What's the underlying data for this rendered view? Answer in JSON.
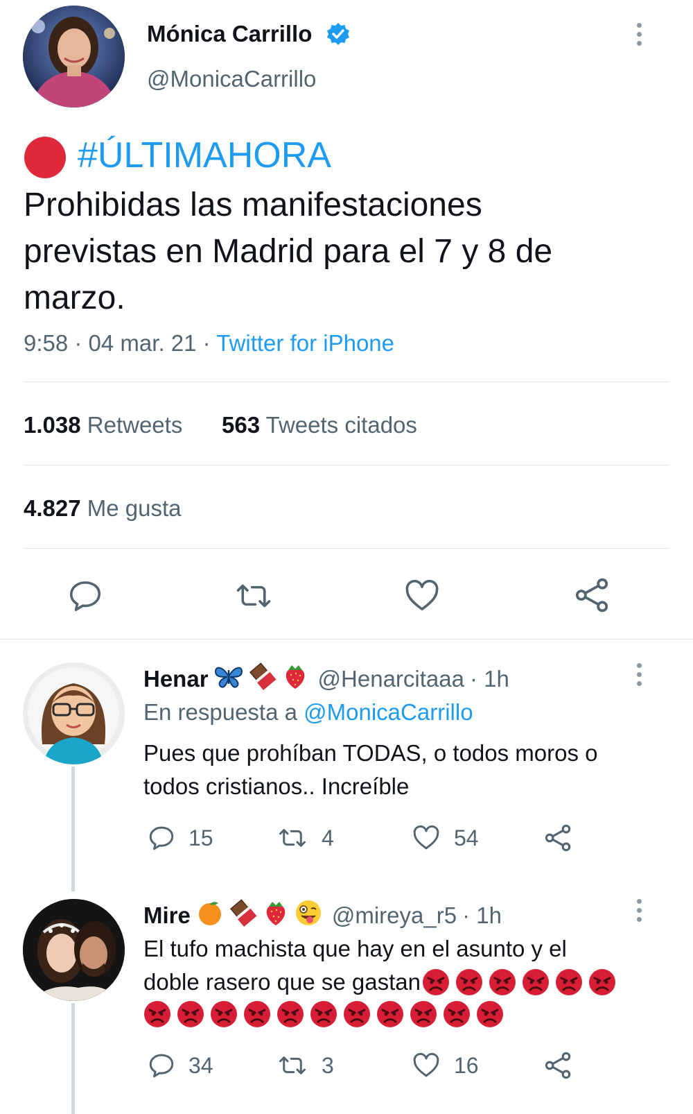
{
  "tweet": {
    "author_name": "Mónica Carrillo",
    "author_handle": "@MonicaCarrillo",
    "hashtag": "#ÚLTIMAHORA",
    "text_lines": [
      "Prohibidas las manifestaciones",
      "previstas en Madrid para el 7 y 8 de",
      "marzo."
    ],
    "timestamp": "9:58 · 04 mar. 21 ·",
    "source": "Twitter for iPhone",
    "stats": {
      "retweets_count": "1.038",
      "retweets_label": "Retweets",
      "quotes_count": "563",
      "quotes_label": "Tweets citados",
      "likes_count": "4.827",
      "likes_label": "Me gusta"
    },
    "actions": [
      "reply-icon",
      "retweet-icon",
      "like-icon",
      "share-icon"
    ]
  },
  "replies": [
    {
      "name": "Henar",
      "name_emojis": [
        "butterfly",
        "chocolate",
        "strawberry"
      ],
      "handle": "@Henarcitaaa",
      "time": "· 1h",
      "reply_to_label": "En respuesta a",
      "reply_to_handle": "@MonicaCarrillo",
      "text_lines": [
        "Pues que prohíban TODAS, o todos moros o",
        "todos cristianos.. Increíble"
      ],
      "replies": "15",
      "retweets": "4",
      "likes": "54"
    },
    {
      "name": "Mire",
      "name_emojis": [
        "orange",
        "chocolate",
        "strawberry",
        "zany-face"
      ],
      "handle": "@mireya_r5",
      "time": "· 1h",
      "text_lines": [
        "El tufo machista que hay en el asunto y el",
        "doble rasero que se gastan"
      ],
      "angry_emoji_count_line1": 6,
      "angry_emoji_count_line2": 11,
      "replies": "34",
      "retweets": "3",
      "likes": "16"
    }
  ],
  "colors": {
    "link": "#1d9bf0",
    "muted": "#536471",
    "divider": "#e1e8ed",
    "live_dot": "#e0283a",
    "verified": "#1d9bf0"
  }
}
